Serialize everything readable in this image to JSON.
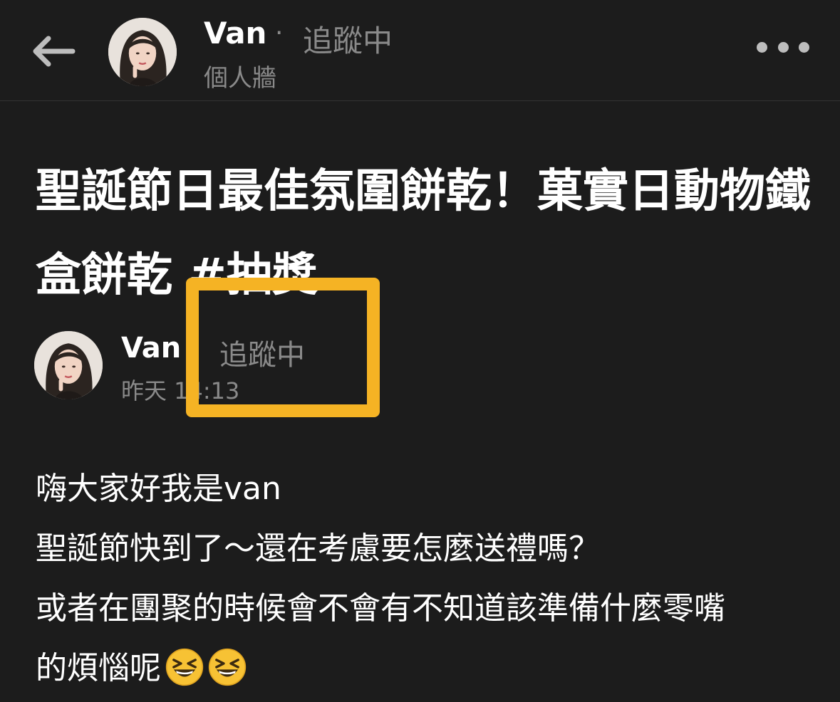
{
  "header": {
    "name": "Van",
    "separator": "·",
    "follow_status": "追蹤中",
    "subtitle": "個人牆"
  },
  "post": {
    "title": "聖誕節日最佳氛圍餅乾！菓實日動物鐵盒餅乾 #抽獎",
    "author": {
      "name": "Van",
      "separator": "·",
      "follow_status": "追蹤中",
      "time": "昨天 14:13"
    },
    "body": [
      "嗨大家好我是van",
      "聖誕節快到了～還在考慮要怎麼送禮嗎？",
      "或者在團聚的時候會不會有不知道該準備什麼零嘴",
      "的煩惱呢"
    ],
    "emojis": [
      "grinning-squinting-face",
      "grinning-squinting-face"
    ]
  },
  "colors": {
    "background": "#1c1c1c",
    "text_primary": "#ffffff",
    "text_secondary": "#8a8a8a",
    "highlight": "#f5b324"
  },
  "icons": {
    "back": "arrow-left-icon",
    "more": "more-horizontal-icon"
  }
}
